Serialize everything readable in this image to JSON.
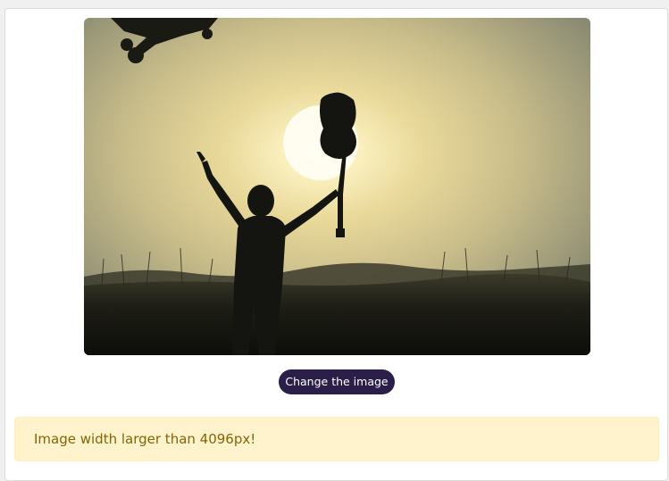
{
  "uploader": {
    "image": {
      "description_icon": "photo-silhouette-guitar-sunset"
    },
    "change_button_label": "Change the image"
  },
  "alert": {
    "message": "Image width larger than 4096px!",
    "variant": "warning",
    "colors": {
      "background": "#fff3cd",
      "border": "#ffeeba",
      "text": "#856404"
    }
  },
  "colors": {
    "button_bg": "#2b1f4a",
    "button_text": "#ffffff"
  }
}
